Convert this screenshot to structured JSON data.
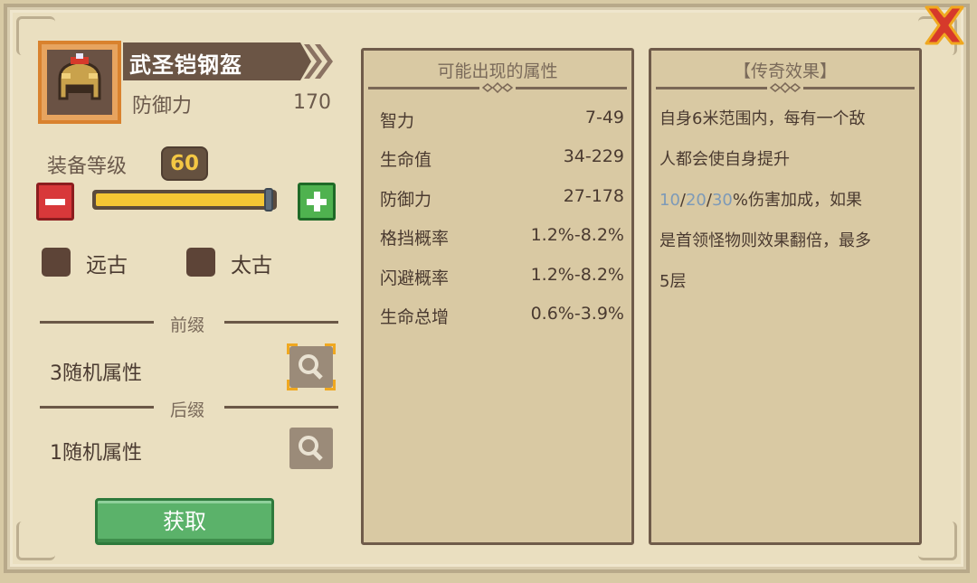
{
  "item": {
    "name": "武圣铠钢盔",
    "stat_label": "防御力",
    "stat_value": "170",
    "icon": "helmet-icon"
  },
  "level": {
    "label": "装备等级",
    "value": "60",
    "progress": 1.0
  },
  "checkboxes": [
    {
      "label": "远古",
      "checked": false
    },
    {
      "label": "太古",
      "checked": false
    }
  ],
  "prefix": {
    "title": "前缀",
    "text": "3随机属性"
  },
  "suffix": {
    "title": "后缀",
    "text": "1随机属性"
  },
  "get_button": "获取",
  "attributes_panel": {
    "title": "可能出现的属性",
    "rows": [
      {
        "name": "智力",
        "range": "7-49"
      },
      {
        "name": "生命值",
        "range": "34-229"
      },
      {
        "name": "防御力",
        "range": "27-178"
      },
      {
        "name": "格挡概率",
        "range": "1.2%-8.2%"
      },
      {
        "name": "闪避概率",
        "range": "1.2%-8.2%"
      },
      {
        "name": "生命总增",
        "range": "0.6%-3.9%"
      }
    ]
  },
  "legend_panel": {
    "title": "【传奇效果】",
    "line1": "自身6米范围内，每有一个敌",
    "line2": "人都会使自身提升",
    "line3_v1": "10",
    "line3_sep1": "/",
    "line3_v2": "20",
    "line3_sep2": "/",
    "line3_v3": "30",
    "line3_rest": "%伤害加成，如果",
    "line4": "是首领怪物则效果翻倍，最多",
    "line5": "5层"
  },
  "colors": {
    "background": "#eadfc0",
    "panel": "#d9c9a3",
    "accent_gold": "#f4c534",
    "button_green": "#5bb26a",
    "button_red": "#d8383a",
    "close_red": "#d6392b",
    "highlight_blue": "#7d9ab8"
  }
}
